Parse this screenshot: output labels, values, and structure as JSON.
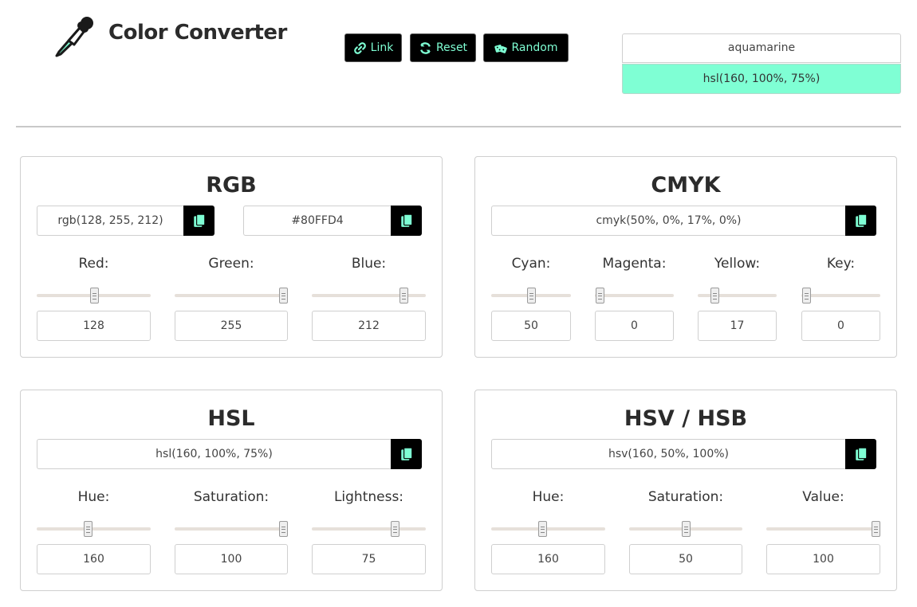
{
  "app": {
    "title": "Color Converter"
  },
  "toolbar": {
    "link_label": "Link",
    "reset_label": "Reset",
    "random_label": "Random",
    "accent": "#7fffd4"
  },
  "preview": {
    "name": "aquamarine",
    "value": "hsl(160, 100%, 75%)",
    "color": "#7fffd4"
  },
  "rgb": {
    "title": "RGB",
    "string": "rgb(128, 255, 212)",
    "hex": "#80FFD4",
    "channels": [
      {
        "label": "Red:",
        "value": "128",
        "level": 0.502
      },
      {
        "label": "Green:",
        "value": "255",
        "level": 1.0
      },
      {
        "label": "Blue:",
        "value": "212",
        "level": 0.831
      }
    ]
  },
  "cmyk": {
    "title": "CMYK",
    "string": "cmyk(50%, 0%, 17%, 0%)",
    "channels": [
      {
        "label": "Cyan:",
        "value": "50",
        "level": 0.5
      },
      {
        "label": "Magenta:",
        "value": "0",
        "level": 0.0
      },
      {
        "label": "Yellow:",
        "value": "17",
        "level": 0.17
      },
      {
        "label": "Key:",
        "value": "0",
        "level": 0.0
      }
    ]
  },
  "hsl": {
    "title": "HSL",
    "string": "hsl(160, 100%, 75%)",
    "channels": [
      {
        "label": "Hue:",
        "value": "160",
        "level": 0.444
      },
      {
        "label": "Saturation:",
        "value": "100",
        "level": 1.0
      },
      {
        "label": "Lightness:",
        "value": "75",
        "level": 0.75
      }
    ]
  },
  "hsv": {
    "title": "HSV / HSB",
    "string": "hsv(160, 50%, 100%)",
    "channels": [
      {
        "label": "Hue:",
        "value": "160",
        "level": 0.444
      },
      {
        "label": "Saturation:",
        "value": "50",
        "level": 0.5
      },
      {
        "label": "Value:",
        "value": "100",
        "level": 1.0
      }
    ]
  }
}
